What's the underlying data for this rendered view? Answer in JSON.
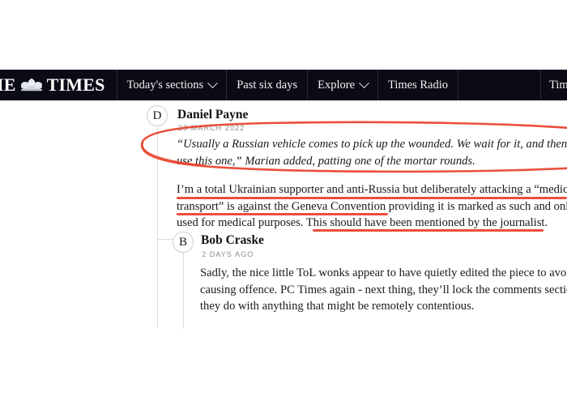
{
  "navbar": {
    "logo": {
      "text_before": "IE",
      "crest_icon": "lion-crest-icon",
      "text_after": "TIMES"
    },
    "items": [
      {
        "label": "Today's sections",
        "has_chevron": true,
        "icon": "chevron-down-icon"
      },
      {
        "label": "Past six days",
        "has_chevron": false,
        "icon": ""
      },
      {
        "label": "Explore",
        "has_chevron": true,
        "icon": "chevron-down-icon"
      },
      {
        "label": "Times Radio",
        "has_chevron": false,
        "icon": ""
      }
    ],
    "truncated_right_item": "Time",
    "background_color": "#0b0b16",
    "text_color": "#f2f2f2"
  },
  "comments": [
    {
      "avatar_initial": "D",
      "author": "Daniel Payne",
      "timestamp": "23 MARCH 2022",
      "lines": [
        "“Usually a Russian vehicle comes to pick up the wounded. We wait for it, and then w",
        "use this one,” Marian added, patting one of the mortar rounds."
      ],
      "style": "italic"
    },
    {
      "avatar_initial": "D",
      "author": "",
      "timestamp": "",
      "lines": [
        "I’m a total Ukrainian supporter and anti-Russia but deliberately attacking a “medica",
        "transport” is against the Geneva Convention providing it is marked as such and only",
        "used for medical purposes. This should have been mentioned by the journalist."
      ],
      "style": "normal"
    },
    {
      "avatar_initial": "B",
      "author": "Bob Craske",
      "timestamp": "2 DAYS AGO",
      "lines": [
        "Sadly, the nice little ToL wonks appear to have quietly edited the piece to avoid",
        "causing offence. PC Times again - next thing, they’ll lock the comments section",
        "they do with anything that might be remotely contentious."
      ],
      "style": "normal"
    }
  ],
  "annotations": {
    "color": "#e8402a",
    "ellipse": {
      "name": "red-ellipse-highlight",
      "encircles": "“Usually a Russian vehicle comes to pick up the wounded...mortar rounds.”"
    },
    "underlines": [
      {
        "name": "underline-medical-attack",
        "target": "deliberately attacking a “medical"
      },
      {
        "name": "underline-geneva-convention",
        "target": "transport” is against the Geneva Convention"
      },
      {
        "name": "underline-should-be-mentioned",
        "target": "This should have been mentioned by the journalist."
      }
    ]
  }
}
